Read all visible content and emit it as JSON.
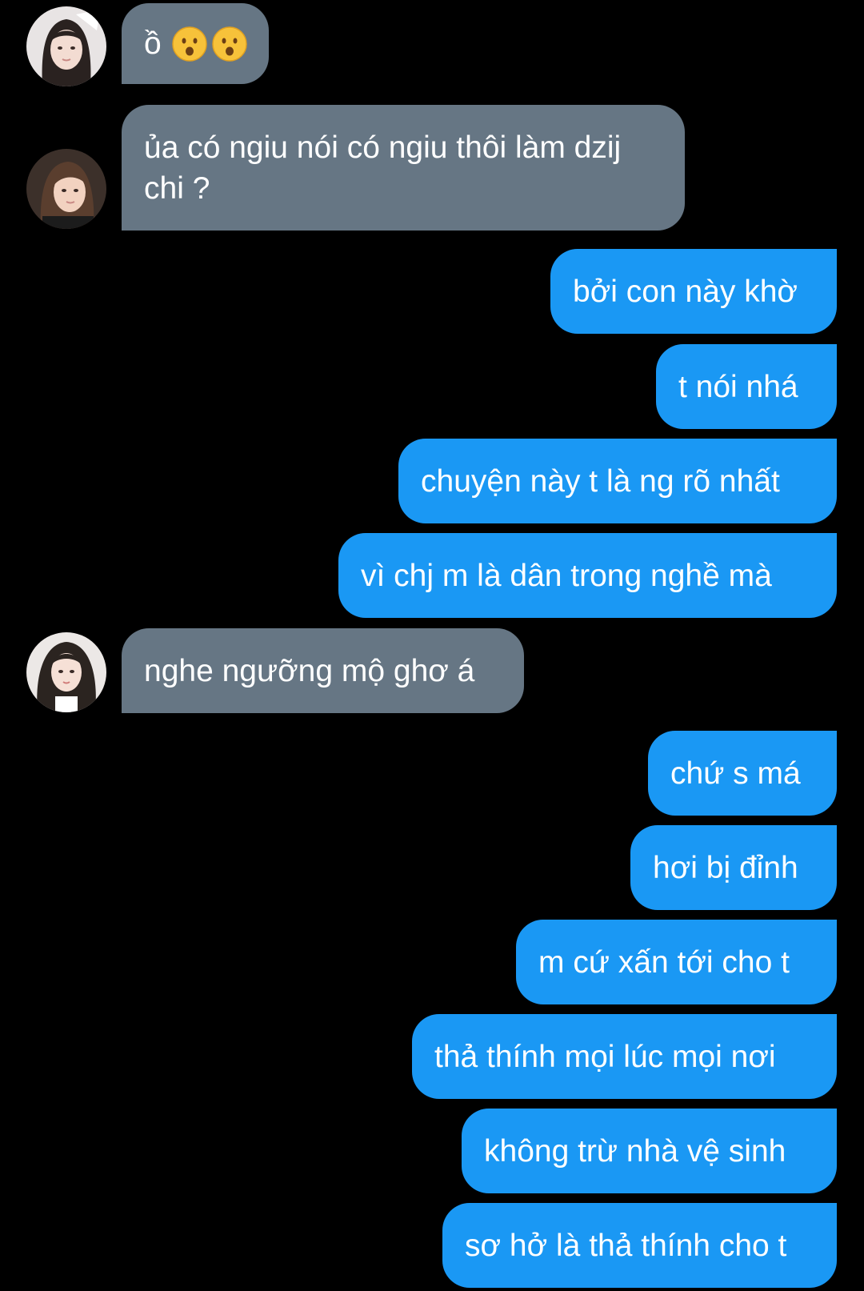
{
  "conversation": {
    "messages": [
      {
        "side": "received",
        "text": "ồ"
      },
      {
        "side": "received",
        "text": "ủa có ngiu nói có ngiu thôi làm dzij chi ?"
      },
      {
        "side": "sent",
        "text": "bởi con này khờ"
      },
      {
        "side": "sent",
        "text": "t nói nhá"
      },
      {
        "side": "sent",
        "text": "chuyện này t là ng rõ nhất"
      },
      {
        "side": "sent",
        "text": "vì chj m là dân trong nghề mà"
      },
      {
        "side": "received",
        "text": "nghe ngưỡng mộ ghơ á"
      },
      {
        "side": "sent",
        "text": "chứ s má"
      },
      {
        "side": "sent",
        "text": "hơi bị đỉnh"
      },
      {
        "side": "sent",
        "text": "m cứ xấn tới cho t"
      },
      {
        "side": "sent",
        "text": "thả thính mọi lúc mọi nơi"
      },
      {
        "side": "sent",
        "text": "không trừ nhà vệ sinh"
      },
      {
        "side": "sent",
        "text": "sơ hở là thả thính cho t"
      }
    ],
    "first_message_emoji": [
      "frowning-open-mouth-emoji",
      "frowning-open-mouth-emoji"
    ]
  },
  "colors": {
    "background": "#000000",
    "received_bubble": "#667684",
    "sent_bubble": "#1a98f4",
    "text": "#ffffff"
  }
}
